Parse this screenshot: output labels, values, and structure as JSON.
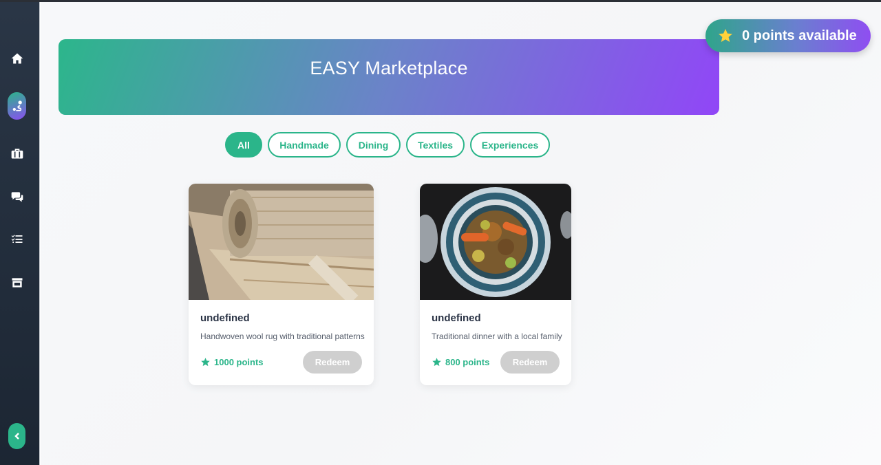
{
  "app": {
    "banner_title": "EASY Marketplace",
    "points_badge": "0 points available"
  },
  "sidebar": {
    "items": [
      {
        "icon": "home-icon"
      },
      {
        "icon": "route-icon",
        "active": true
      },
      {
        "icon": "briefcase-icon"
      },
      {
        "icon": "chat-icon"
      },
      {
        "icon": "task-list-icon"
      },
      {
        "icon": "store-icon"
      }
    ],
    "collapse_icon": "chevron-left-icon"
  },
  "filters": [
    {
      "label": "All",
      "active": true
    },
    {
      "label": "Handmade"
    },
    {
      "label": "Dining"
    },
    {
      "label": "Textiles"
    },
    {
      "label": "Experiences"
    }
  ],
  "products": [
    {
      "title": "undefined",
      "description": "Handwoven wool rug with traditional patterns",
      "points": "1000 points",
      "action": "Redeem",
      "image": "rolled-rug-photo"
    },
    {
      "title": "undefined",
      "description": "Traditional dinner with a local family",
      "points": "800 points",
      "action": "Redeem",
      "image": "tagine-dish-photo"
    }
  ],
  "colors": {
    "accent": "#2bb58a",
    "gradient_end": "#9146f7",
    "sidebar_bg": "#1f2a38",
    "disabled_button": "#cfcfcf",
    "star": "#ffd23a"
  }
}
